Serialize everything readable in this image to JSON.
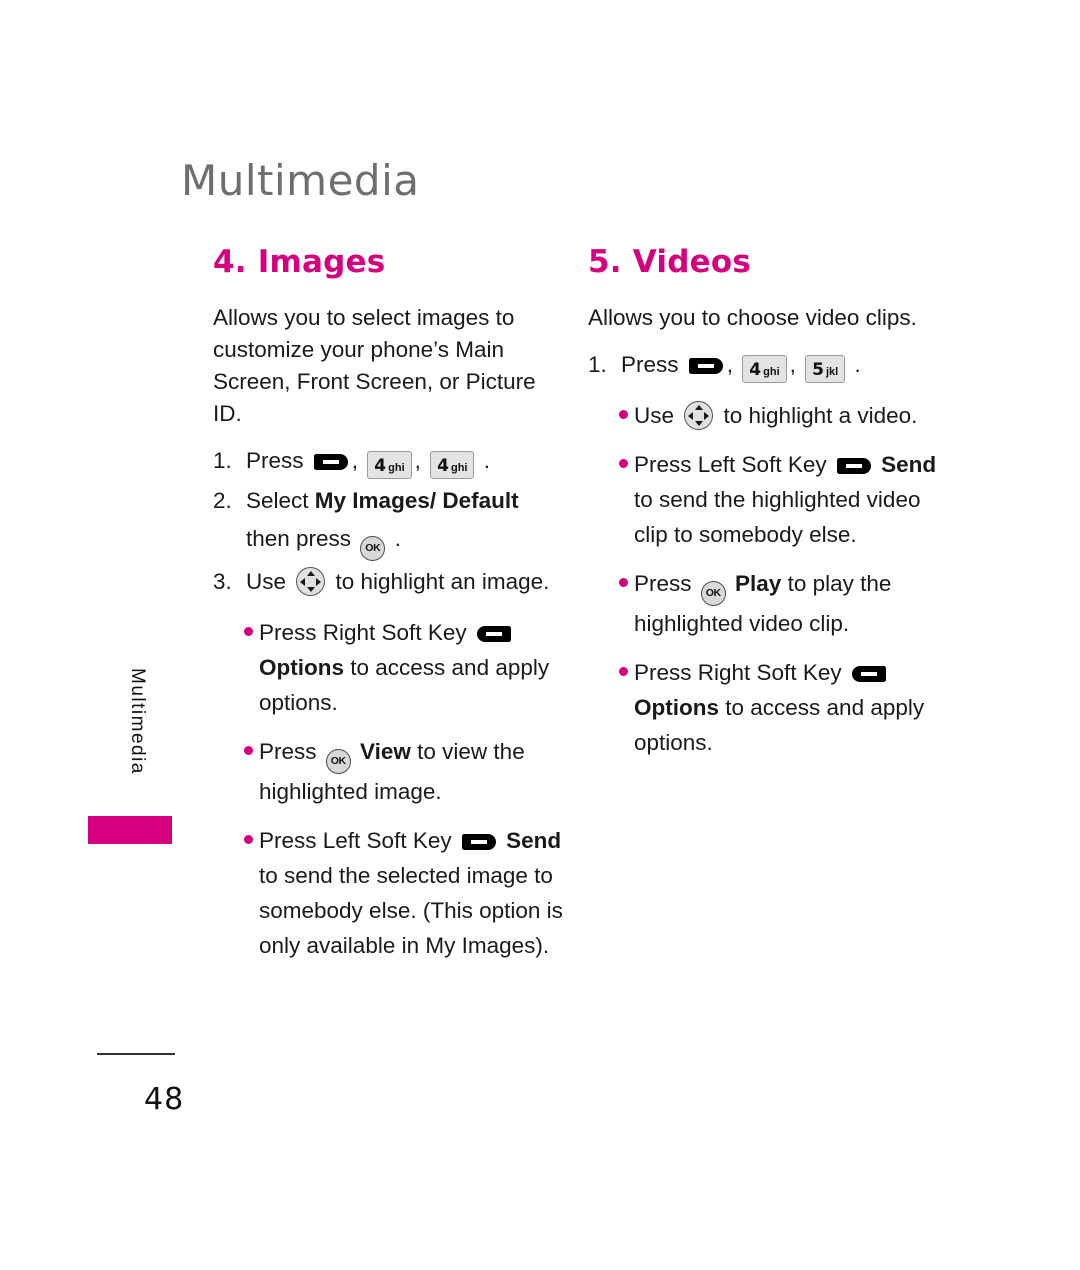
{
  "chapter": {
    "title": "Multimedia",
    "side_tab_label": "Multimedia",
    "accent_color": "#d4007f",
    "title_color": "#6e6e6e"
  },
  "footer": {
    "page_number": "48"
  },
  "sections": [
    {
      "heading": "4. Images",
      "intro": "Allows you to select images to customize your phone’s Main Screen, Front Screen, or Picture ID.",
      "steps": [
        {
          "num": "1.",
          "parts": [
            {
              "t": "text",
              "v": "Press "
            },
            {
              "t": "key-soft-left",
              "v": "left-soft-key"
            },
            {
              "t": "text",
              "v": ", "
            },
            {
              "t": "key-num",
              "digit": "4",
              "letters": "ghi"
            },
            {
              "t": "text",
              "v": ", "
            },
            {
              "t": "key-num",
              "digit": "4",
              "letters": "ghi"
            },
            {
              "t": "text",
              "v": " ."
            }
          ]
        },
        {
          "num": "2.",
          "parts": [
            {
              "t": "text",
              "v": "Select "
            },
            {
              "t": "bold",
              "v": "My Images/ Default"
            },
            {
              "t": "text",
              "v": " then press "
            },
            {
              "t": "key-ok",
              "v": "OK"
            },
            {
              "t": "text",
              "v": " ."
            }
          ]
        },
        {
          "num": "3.",
          "parts": [
            {
              "t": "text",
              "v": "Use "
            },
            {
              "t": "key-nav",
              "v": "navigation-key"
            },
            {
              "t": "text",
              "v": " to highlight an image."
            }
          ]
        }
      ],
      "bullets": [
        {
          "parts": [
            {
              "t": "text",
              "v": "Press Right Soft Key "
            },
            {
              "t": "key-soft-right",
              "v": "right-soft-key"
            },
            {
              "t": "text",
              "v": " "
            },
            {
              "t": "bold",
              "v": "Options"
            },
            {
              "t": "text",
              "v": " to access and apply options."
            }
          ]
        },
        {
          "parts": [
            {
              "t": "text",
              "v": "Press "
            },
            {
              "t": "key-ok",
              "v": "OK"
            },
            {
              "t": "text",
              "v": " "
            },
            {
              "t": "bold",
              "v": "View"
            },
            {
              "t": "text",
              "v": " to view the highlighted image."
            }
          ]
        },
        {
          "parts": [
            {
              "t": "text",
              "v": "Press Left Soft Key "
            },
            {
              "t": "key-soft-left",
              "v": "left-soft-key"
            },
            {
              "t": "text",
              "v": " "
            },
            {
              "t": "bold",
              "v": "Send"
            },
            {
              "t": "text",
              "v": " to send the selected image to somebody else. (This option is only available in My Images)."
            }
          ]
        }
      ]
    },
    {
      "heading": "5. Videos",
      "intro": "Allows you to choose video clips.",
      "steps": [
        {
          "num": "1.",
          "parts": [
            {
              "t": "text",
              "v": "Press "
            },
            {
              "t": "key-soft-left",
              "v": "left-soft-key"
            },
            {
              "t": "text",
              "v": ", "
            },
            {
              "t": "key-num",
              "digit": "4",
              "letters": "ghi"
            },
            {
              "t": "text",
              "v": ", "
            },
            {
              "t": "key-num",
              "digit": "5",
              "letters": "jkl"
            },
            {
              "t": "text",
              "v": " ."
            }
          ]
        }
      ],
      "bullets": [
        {
          "parts": [
            {
              "t": "text",
              "v": "Use "
            },
            {
              "t": "key-nav",
              "v": "navigation-key"
            },
            {
              "t": "text",
              "v": " to highlight a video."
            }
          ]
        },
        {
          "parts": [
            {
              "t": "text",
              "v": "Press Left Soft Key "
            },
            {
              "t": "key-soft-left",
              "v": "left-soft-key"
            },
            {
              "t": "text",
              "v": " "
            },
            {
              "t": "bold",
              "v": "Send"
            },
            {
              "t": "text",
              "v": " to send the highlighted video clip to somebody else."
            }
          ]
        },
        {
          "parts": [
            {
              "t": "text",
              "v": "Press "
            },
            {
              "t": "key-ok",
              "v": "OK"
            },
            {
              "t": "text",
              "v": " "
            },
            {
              "t": "bold",
              "v": "Play"
            },
            {
              "t": "text",
              "v": " to play the highlighted video clip."
            }
          ]
        },
        {
          "parts": [
            {
              "t": "text",
              "v": "Press Right Soft Key "
            },
            {
              "t": "key-soft-right",
              "v": "right-soft-key"
            },
            {
              "t": "text",
              "v": " "
            },
            {
              "t": "bold",
              "v": "Options"
            },
            {
              "t": "text",
              "v": " to access and apply options."
            }
          ]
        }
      ]
    }
  ]
}
